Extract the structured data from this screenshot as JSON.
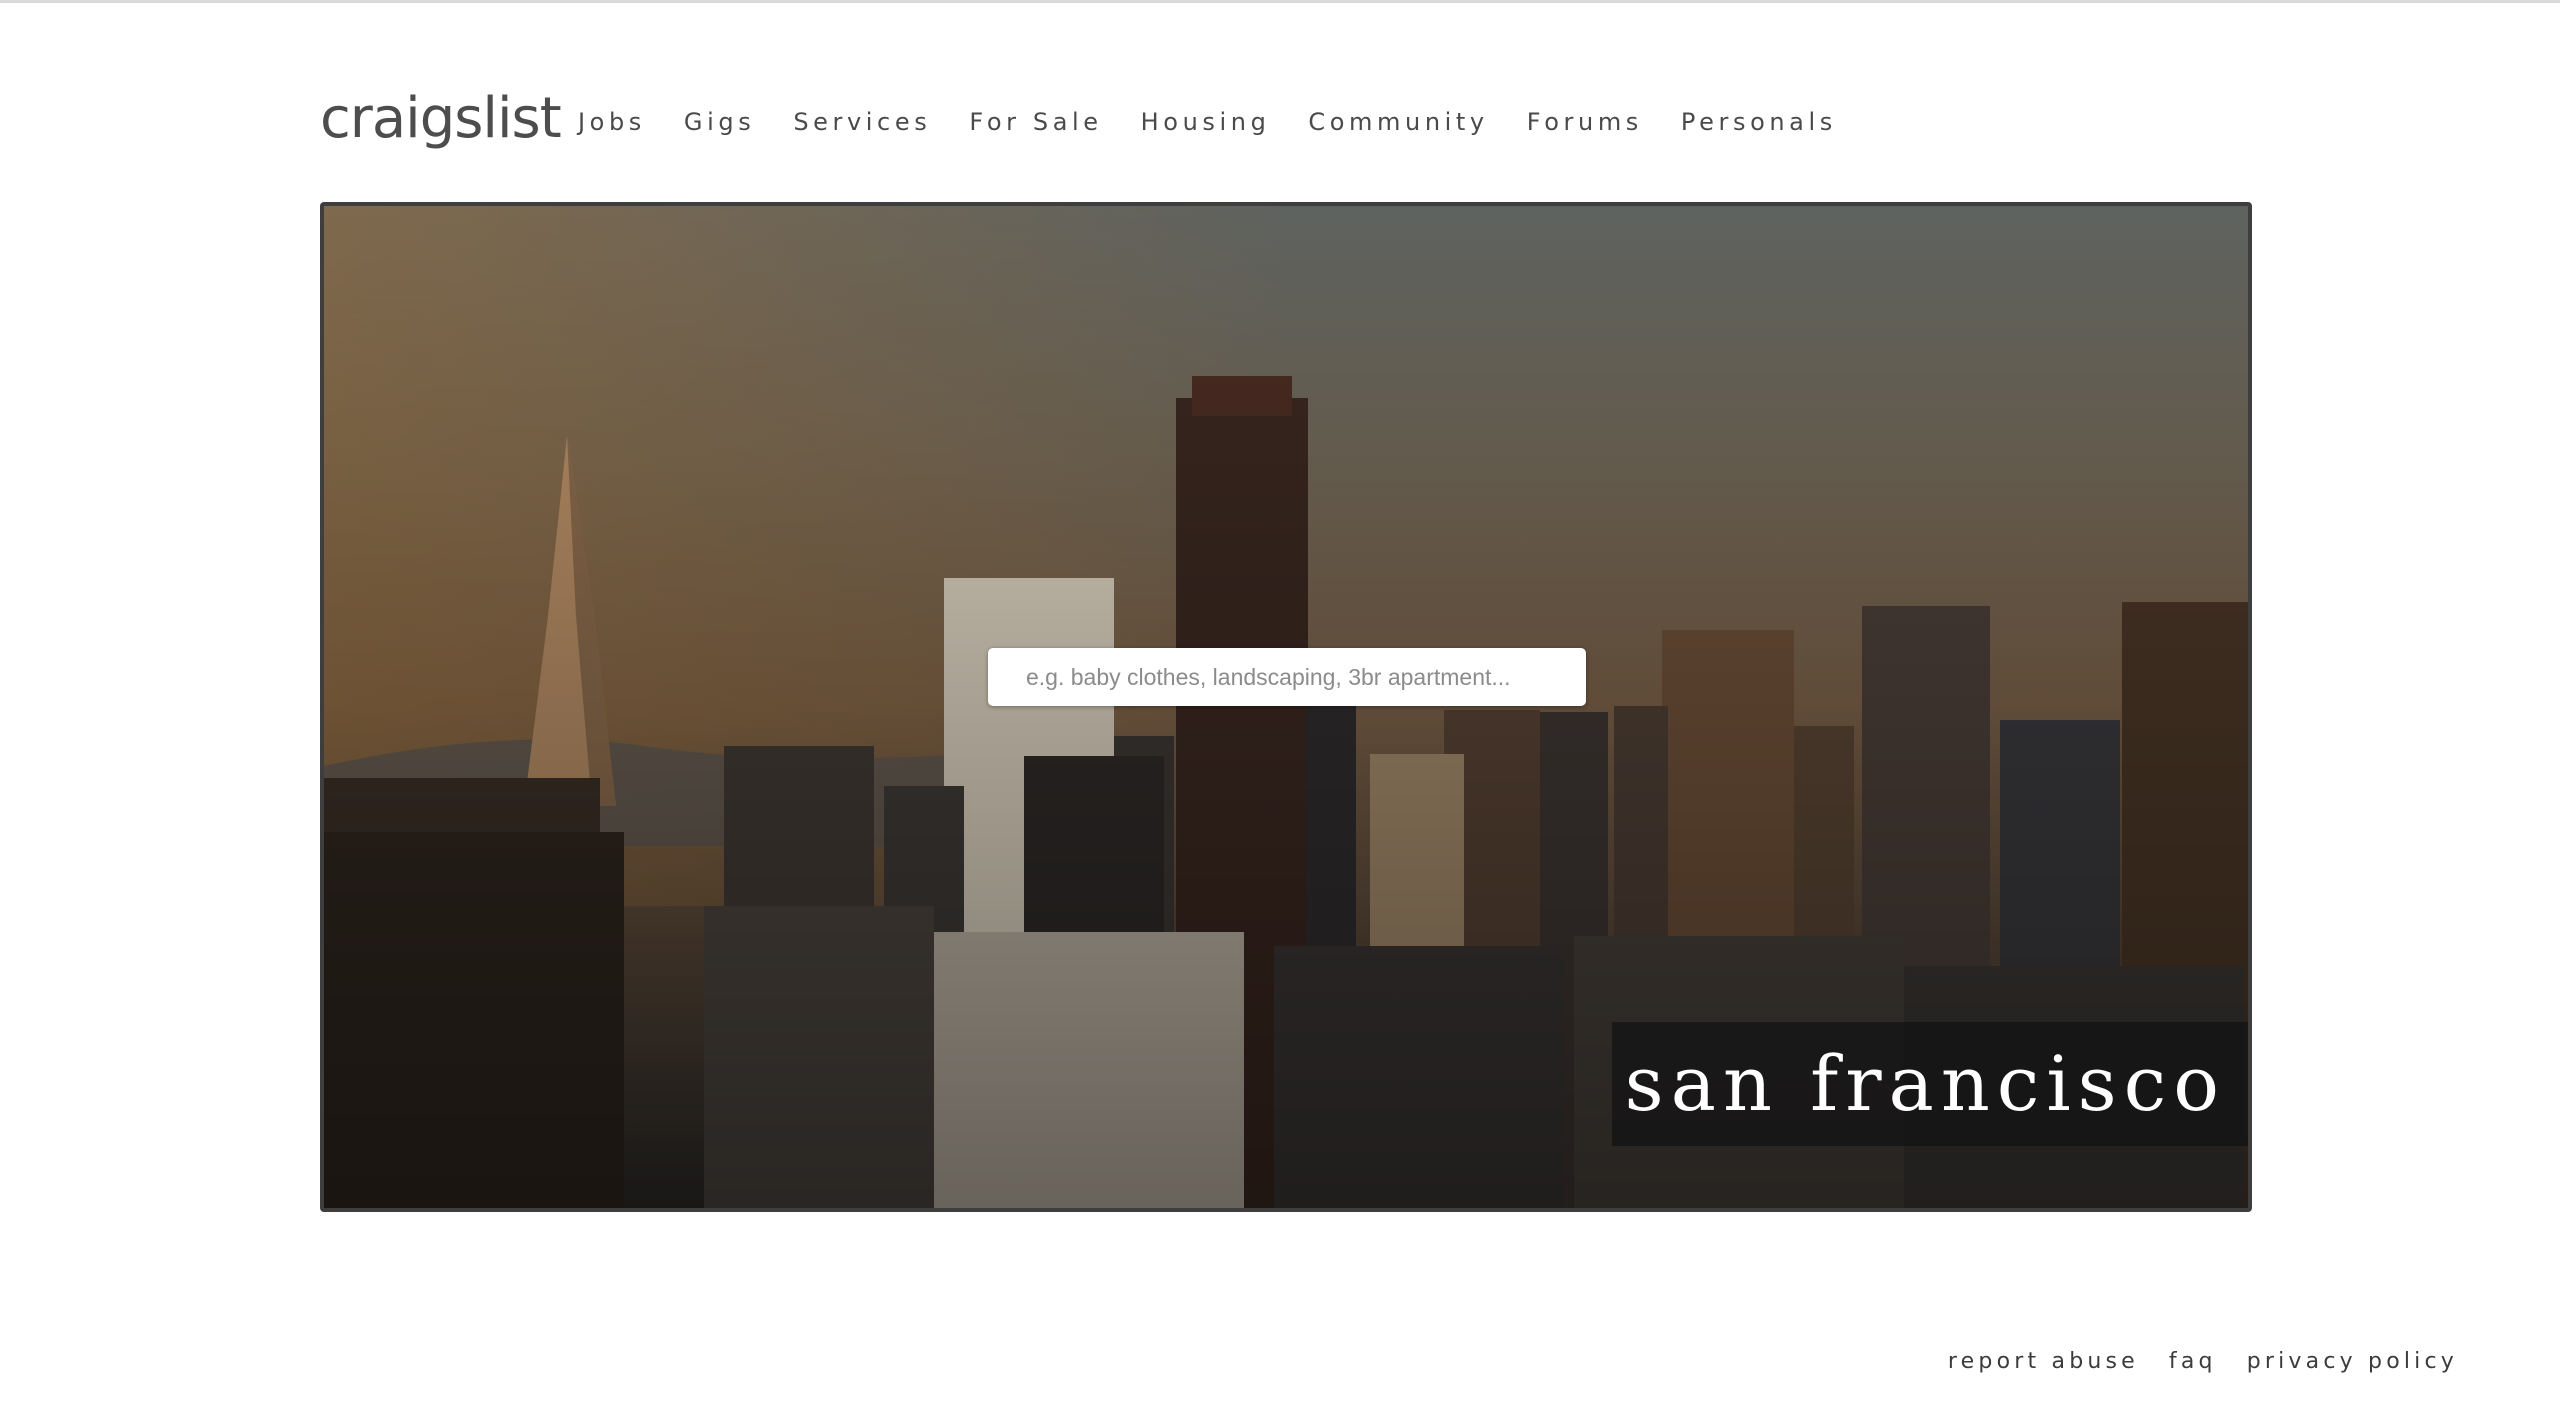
{
  "header": {
    "logo": "craigslist",
    "nav": [
      {
        "label": "Jobs"
      },
      {
        "label": "Gigs"
      },
      {
        "label": "Services"
      },
      {
        "label": "For Sale"
      },
      {
        "label": "Housing"
      },
      {
        "label": "Community"
      },
      {
        "label": "Forums"
      },
      {
        "label": "Personals"
      }
    ]
  },
  "hero": {
    "search": {
      "placeholder": "e.g. baby clothes, landscaping, 3br apartment...",
      "value": ""
    },
    "city": "san francisco"
  },
  "footer": {
    "links": [
      {
        "label": "report abuse"
      },
      {
        "label": "faq"
      },
      {
        "label": "privacy policy"
      }
    ]
  },
  "colors": {
    "accent_text": "#4d4d4d",
    "hero_border": "#3e3e3e",
    "sky_warm": "#7a6149",
    "city_label": "#ffffff"
  }
}
